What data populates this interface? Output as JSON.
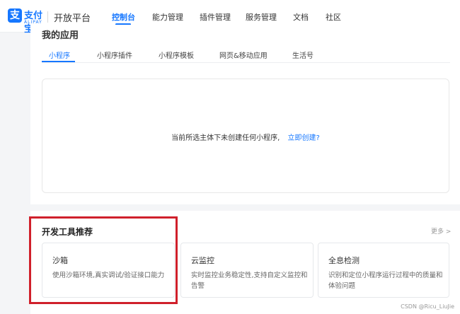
{
  "brand": {
    "logo_glyph": "支",
    "logo_name": "支付宝",
    "logo_sub": "ALIPAY",
    "platform": "开放平台",
    "accent_color": "#1677ff"
  },
  "nav": {
    "items": [
      {
        "label": "控制台",
        "active": true
      },
      {
        "label": "能力管理"
      },
      {
        "label": "插件管理"
      },
      {
        "label": "服务管理"
      },
      {
        "label": "文档"
      },
      {
        "label": "社区"
      }
    ]
  },
  "apps": {
    "title": "我的应用",
    "tabs": [
      {
        "label": "小程序",
        "active": true
      },
      {
        "label": "小程序插件"
      },
      {
        "label": "小程序模板"
      },
      {
        "label": "网页&移动应用"
      },
      {
        "label": "生活号"
      }
    ],
    "empty_text": "当前所选主体下未创建任何小程序,",
    "create_link": "立即创建?"
  },
  "tools": {
    "title": "开发工具推荐",
    "more": "更多 >",
    "cards": [
      {
        "name": "沙箱",
        "desc": "使用沙箱环境,真实调试/验证接口能力"
      },
      {
        "name": "云监控",
        "desc": "实时监控业务稳定性,支持自定义监控和告警"
      },
      {
        "name": "全息检测",
        "desc": "识别和定位小程序运行过程中的质量和体验问题"
      }
    ]
  },
  "highlight_color": "#d0202b",
  "watermark": "CSDN @Ricu_LiuJie"
}
